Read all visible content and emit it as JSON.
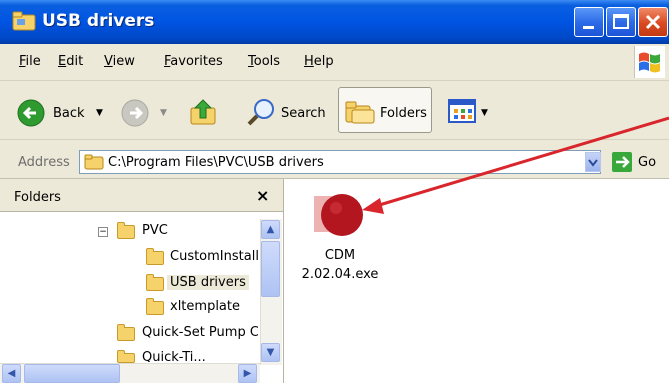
{
  "window": {
    "title": "USB drivers",
    "controls": [
      "minimize",
      "maximize",
      "close"
    ]
  },
  "menu": [
    "File",
    "Edit",
    "View",
    "Favorites",
    "Tools",
    "Help"
  ],
  "toolbar": {
    "back_label": "Back",
    "search_label": "Search",
    "folders_label": "Folders"
  },
  "address": {
    "label": "Address",
    "path": "C:\\Program Files\\PVC\\USB drivers",
    "go_label": "Go"
  },
  "folders_pane": {
    "title": "Folders",
    "close_glyph": "×",
    "tree": [
      {
        "label": "PVC",
        "expander": "−"
      },
      {
        "label": "CustomInstall"
      },
      {
        "label": "USB drivers",
        "selected": true
      },
      {
        "label": "xltemplate"
      },
      {
        "label": "Quick-Set Pump C"
      },
      {
        "label": "Quick-Ti..."
      }
    ]
  },
  "files": [
    {
      "name_line1": "CDM",
      "name_line2": "2.02.04.exe",
      "icon": "installer-icon"
    }
  ],
  "colors": {
    "title_bar": "#0054e3",
    "arrow": "#d9262c",
    "file_icon": "#b41620",
    "go_button": "#39a83a"
  }
}
